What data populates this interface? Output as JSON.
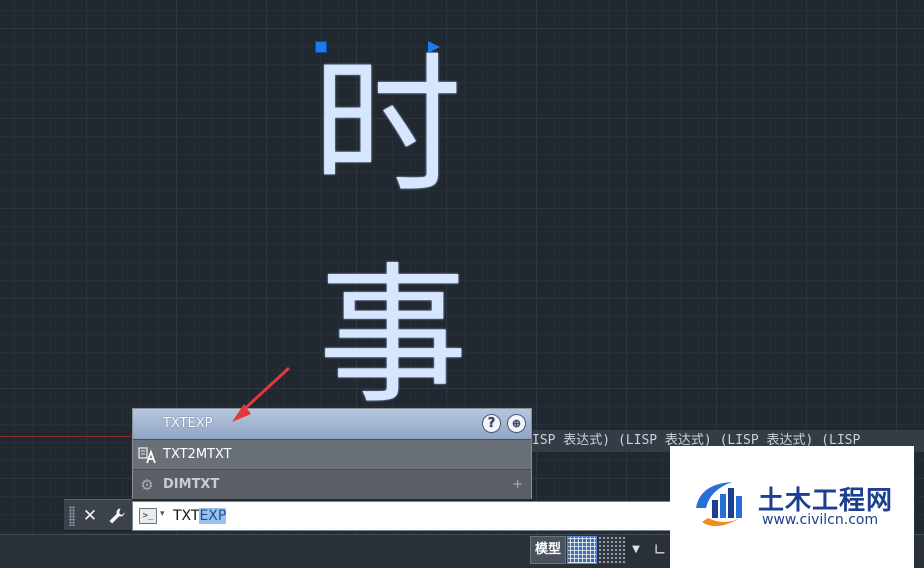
{
  "drawing": {
    "glyph_1": "时",
    "glyph_2": "事",
    "lisp_strip": "ISP 表达式) (LISP 表达式) (LISP 表达式) (LISP"
  },
  "autocomplete": {
    "items": [
      {
        "label": "TXTEXP",
        "icon": "none"
      },
      {
        "label": "TXT2MTXT",
        "icon": "text-convert-icon"
      },
      {
        "label": "DIMTXT",
        "icon": "gear-icon"
      }
    ],
    "help_glyph": "?",
    "globe_glyph": "⊕",
    "expand_glyph": "+"
  },
  "command_line": {
    "close_glyph": "✕",
    "wrench_glyph": "🔧",
    "prompt_glyph": ">_",
    "caret_glyph": "▾",
    "typed": "TXT",
    "autocompleted": "EXP"
  },
  "statusbar": {
    "model_label": "模型",
    "snap_dropdown_glyph": "▼",
    "ortho_glyph": "∟"
  },
  "watermark": {
    "title": "土木工程网",
    "url": "www.civilcn.com"
  },
  "colors": {
    "canvas": "#212830",
    "glyph": "#d7e6ff",
    "grip": "#1a7cf0",
    "highlight": "#99c3ee",
    "arrow": "#e23a3a",
    "brand_blue": "#1c3f8f"
  }
}
